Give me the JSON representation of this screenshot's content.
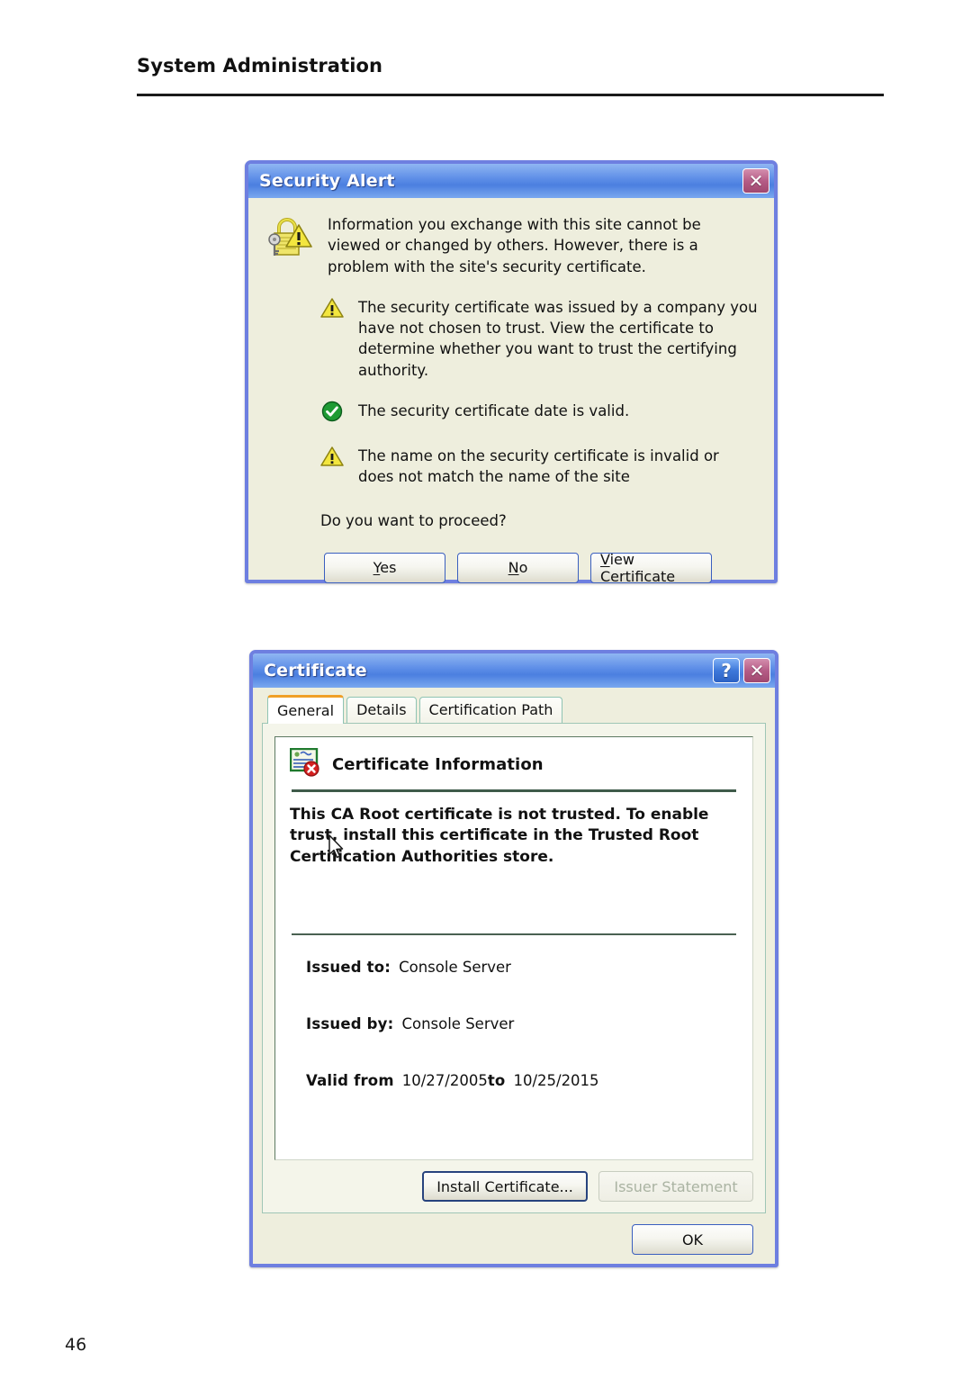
{
  "page": {
    "header_title": "System Administration",
    "page_number": "46"
  },
  "security_alert": {
    "title": "Security Alert",
    "close_icon": "close-icon",
    "intro_icon": "lock-warning-icon",
    "intro_text": "Information you exchange with this site cannot be viewed or changed by others. However, there is a problem with the site's security certificate.",
    "items": [
      {
        "icon": "warning-triangle-icon",
        "status": "warning",
        "text": "The security certificate was issued by a company you have not chosen to trust. View the certificate to determine whether you want to trust the certifying authority."
      },
      {
        "icon": "check-circle-icon",
        "status": "ok",
        "text": "The security certificate date is valid."
      },
      {
        "icon": "warning-triangle-icon",
        "status": "warning",
        "text": "The name on the security certificate is invalid or does not match the name of the site"
      }
    ],
    "question": "Do you want to proceed?",
    "buttons": [
      {
        "label": "Yes",
        "accel": "Y",
        "enabled": true
      },
      {
        "label": "No",
        "accel": "N",
        "enabled": true
      },
      {
        "label": "View Certificate",
        "accel": "V",
        "enabled": true
      }
    ]
  },
  "certificate": {
    "title": "Certificate",
    "help_icon": "question-mark-icon",
    "close_icon": "close-icon",
    "tabs": [
      {
        "label": "General",
        "active": true
      },
      {
        "label": "Details",
        "active": false
      },
      {
        "label": "Certification Path",
        "active": false
      }
    ],
    "info_icon": "certificate-error-icon",
    "info_heading": "Certificate Information",
    "warning_text": "This CA Root certificate is not trusted. To enable trust, install this certificate in the Trusted Root Certification Authorities store.",
    "fields": [
      {
        "label": "Issued to:",
        "value": "Console Server"
      },
      {
        "label": "Issued by:",
        "value": "Console Server"
      }
    ],
    "validity": {
      "label": "Valid from",
      "from": "10/27/2005",
      "separator": "to",
      "to": "10/25/2015"
    },
    "buttons": [
      {
        "label": "Install Certificate...",
        "enabled": true
      },
      {
        "label": "Issuer Statement",
        "enabled": false
      }
    ],
    "ok_button": "OK",
    "cursor": "mouse-pointer-icon"
  },
  "colors": {
    "titlebar_blue": "#4b7fe0",
    "dialog_frame": "#6e7fe0",
    "dialog_face": "#eeeedd",
    "close_button": "#b55c86",
    "active_tab_accent": "#f0a028",
    "warning_yellow": "#f2e23c",
    "ok_green": "#1f9b34",
    "error_red": "#d42020"
  }
}
